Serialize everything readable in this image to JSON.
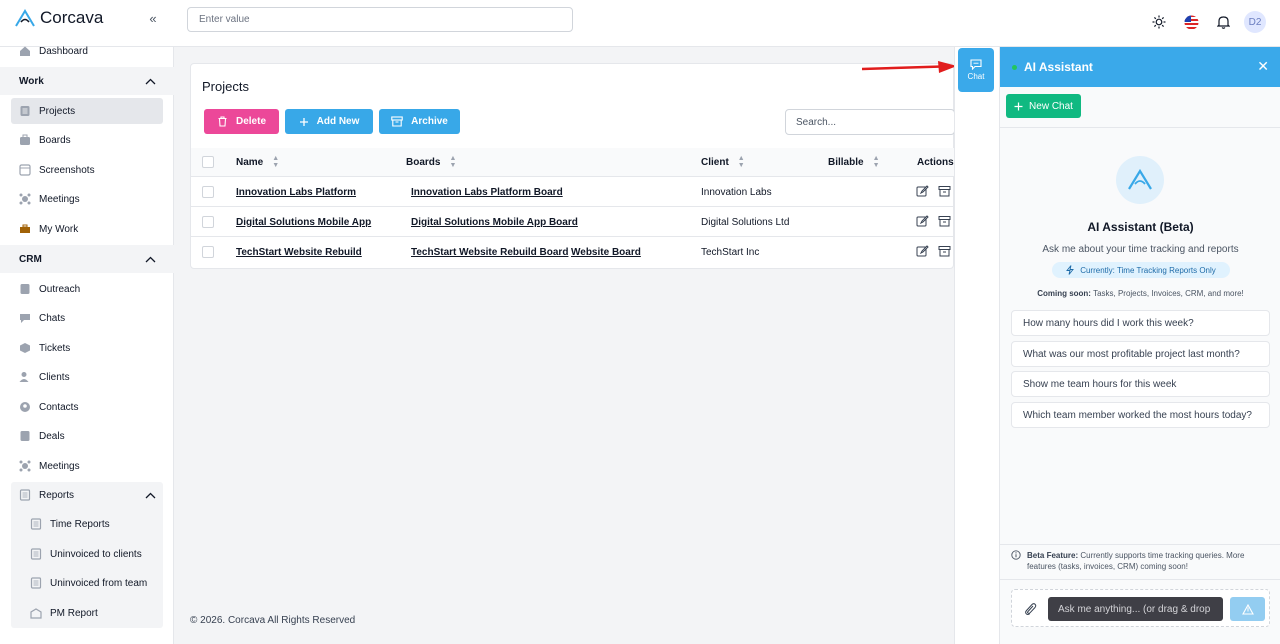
{
  "app": {
    "name": "Corcava",
    "brand_color": "#38a8e8"
  },
  "header": {
    "search_placeholder": "Enter value",
    "avatar_initials": "D2"
  },
  "sidebar": {
    "dashboard": "Dashboard",
    "work_group": "Work",
    "work_items": [
      "Projects",
      "Boards",
      "Screenshots",
      "Meetings",
      "My Work"
    ],
    "crm_group": "CRM",
    "crm_items": [
      "Outreach",
      "Chats",
      "Tickets",
      "Clients",
      "Contacts",
      "Deals",
      "Meetings"
    ],
    "reports_group": "Reports",
    "reports_items": [
      "Time Reports",
      "Uninvoiced to clients",
      "Uninvoiced from team",
      "PM Report"
    ]
  },
  "projects": {
    "title": "Projects",
    "buttons": {
      "delete": "Delete",
      "add": "Add New",
      "archive": "Archive"
    },
    "search_placeholder": "Search...",
    "columns": {
      "name": "Name",
      "boards": "Boards",
      "client": "Client",
      "billable": "Billable",
      "actions": "Actions"
    },
    "rows": [
      {
        "name": "Innovation Labs Platform",
        "boards": [
          "Innovation Labs Platform Board"
        ],
        "client": "Innovation Labs"
      },
      {
        "name": "Digital Solutions Mobile App",
        "boards": [
          "Digital Solutions Mobile App Board"
        ],
        "client": "Digital Solutions Ltd"
      },
      {
        "name": "TechStart Website Rebuild",
        "boards": [
          "TechStart Website Rebuild Board",
          "Website Board"
        ],
        "client": "TechStart Inc"
      }
    ]
  },
  "footer": "© 2026. Corcava All Rights Reserved",
  "chat_tab": "Chat",
  "assistant": {
    "title": "AI Assistant",
    "new_chat": "New Chat",
    "heading": "AI Assistant (Beta)",
    "subtitle": "Ask me about your time tracking and reports",
    "badge": "Currently: Time Tracking Reports Only",
    "soon_label": "Coming soon:",
    "soon_text": " Tasks, Projects, Invoices, CRM, and more!",
    "suggestions": [
      "How many hours did I work this week?",
      "What was our most profitable project last month?",
      "Show me team hours for this week",
      "Which team member worked the most hours today?"
    ],
    "beta_label": "Beta Feature:",
    "beta_text": " Currently supports time tracking queries. More features (tasks, invoices, CRM) coming soon!",
    "input_placeholder": "Ask me anything... (or drag & drop"
  }
}
